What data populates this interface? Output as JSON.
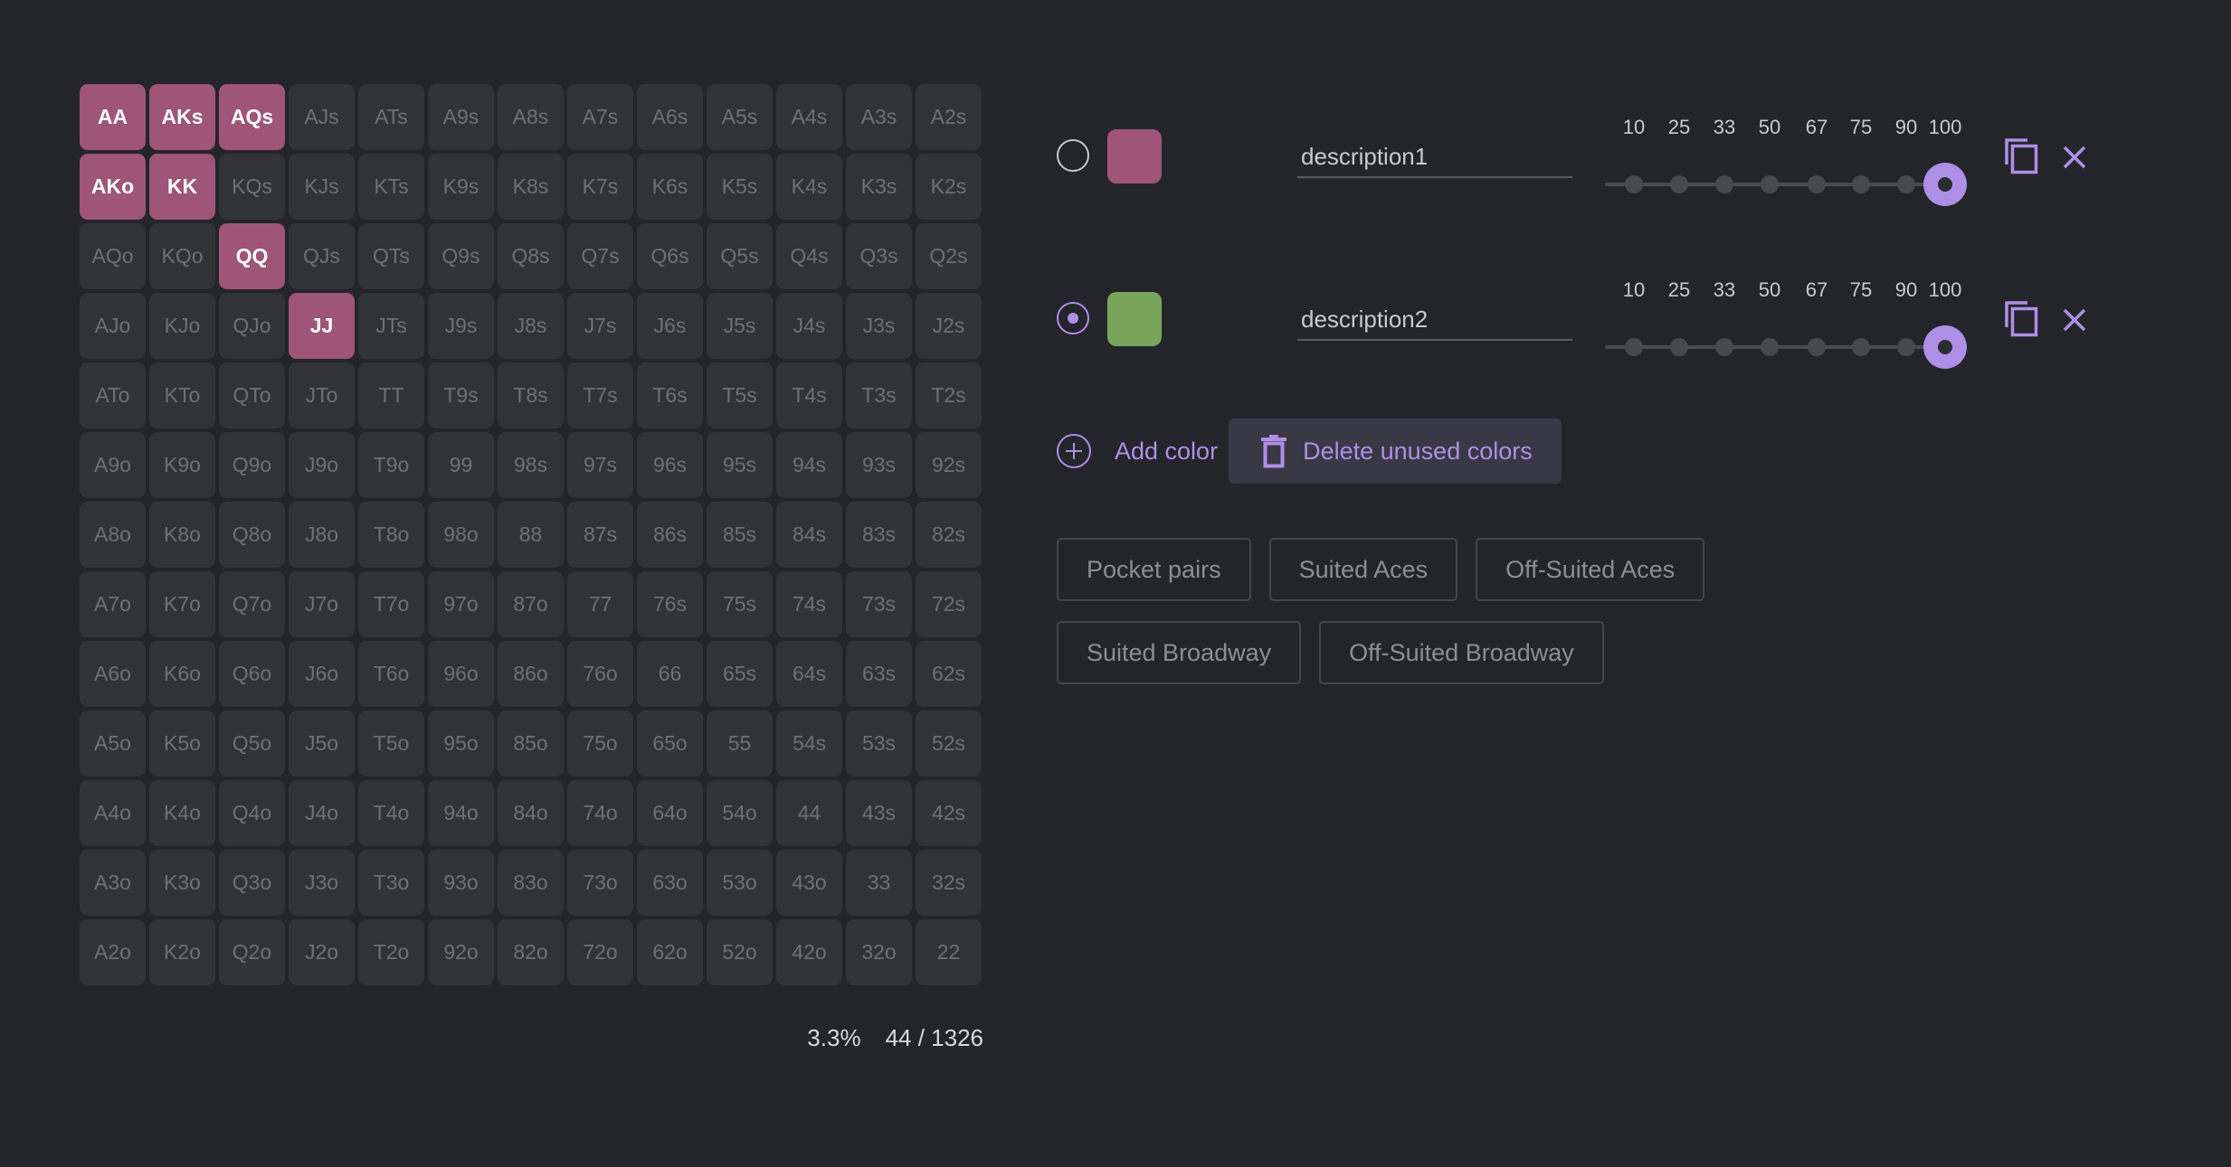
{
  "range_grid": {
    "selected_color": "#9e5577",
    "cells": [
      [
        "AA",
        "AKs",
        "AQs",
        "AJs",
        "ATs",
        "A9s",
        "A8s",
        "A7s",
        "A6s",
        "A5s",
        "A4s",
        "A3s",
        "A2s"
      ],
      [
        "AKo",
        "KK",
        "KQs",
        "KJs",
        "KTs",
        "K9s",
        "K8s",
        "K7s",
        "K6s",
        "K5s",
        "K4s",
        "K3s",
        "K2s"
      ],
      [
        "AQo",
        "KQo",
        "QQ",
        "QJs",
        "QTs",
        "Q9s",
        "Q8s",
        "Q7s",
        "Q6s",
        "Q5s",
        "Q4s",
        "Q3s",
        "Q2s"
      ],
      [
        "AJo",
        "KJo",
        "QJo",
        "JJ",
        "JTs",
        "J9s",
        "J8s",
        "J7s",
        "J6s",
        "J5s",
        "J4s",
        "J3s",
        "J2s"
      ],
      [
        "ATo",
        "KTo",
        "QTo",
        "JTo",
        "TT",
        "T9s",
        "T8s",
        "T7s",
        "T6s",
        "T5s",
        "T4s",
        "T3s",
        "T2s"
      ],
      [
        "A9o",
        "K9o",
        "Q9o",
        "J9o",
        "T9o",
        "99",
        "98s",
        "97s",
        "96s",
        "95s",
        "94s",
        "93s",
        "92s"
      ],
      [
        "A8o",
        "K8o",
        "Q8o",
        "J8o",
        "T8o",
        "98o",
        "88",
        "87s",
        "86s",
        "85s",
        "84s",
        "83s",
        "82s"
      ],
      [
        "A7o",
        "K7o",
        "Q7o",
        "J7o",
        "T7o",
        "97o",
        "87o",
        "77",
        "76s",
        "75s",
        "74s",
        "73s",
        "72s"
      ],
      [
        "A6o",
        "K6o",
        "Q6o",
        "J6o",
        "T6o",
        "96o",
        "86o",
        "76o",
        "66",
        "65s",
        "64s",
        "63s",
        "62s"
      ],
      [
        "A5o",
        "K5o",
        "Q5o",
        "J5o",
        "T5o",
        "95o",
        "85o",
        "75o",
        "65o",
        "55",
        "54s",
        "53s",
        "52s"
      ],
      [
        "A4o",
        "K4o",
        "Q4o",
        "J4o",
        "T4o",
        "94o",
        "84o",
        "74o",
        "64o",
        "54o",
        "44",
        "43s",
        "42s"
      ],
      [
        "A3o",
        "K3o",
        "Q3o",
        "J3o",
        "T3o",
        "93o",
        "83o",
        "73o",
        "63o",
        "53o",
        "43o",
        "33",
        "32s"
      ],
      [
        "A2o",
        "K2o",
        "Q2o",
        "J2o",
        "T2o",
        "92o",
        "82o",
        "72o",
        "62o",
        "52o",
        "42o",
        "32o",
        "22"
      ]
    ],
    "selected": [
      "AA",
      "AKs",
      "AQs",
      "AKo",
      "KK",
      "QQ",
      "JJ"
    ]
  },
  "stats": {
    "percent": "3.3%",
    "combos": "44 / 1326"
  },
  "colors": [
    {
      "swatch": "#9e5577",
      "description": "description1",
      "active": false,
      "frequency_options": [
        "10",
        "25",
        "33",
        "50",
        "67",
        "75",
        "90",
        "100"
      ],
      "frequency": "100",
      "copy_icon": "copy-icon",
      "delete_icon": "close-icon"
    },
    {
      "swatch": "#79a55a",
      "description": "description2",
      "active": true,
      "frequency_options": [
        "10",
        "25",
        "33",
        "50",
        "67",
        "75",
        "90",
        "100"
      ],
      "frequency": "100",
      "copy_icon": "copy-icon",
      "delete_icon": "close-icon"
    }
  ],
  "actions": {
    "add_color_label": "Add color",
    "delete_unused_label": "Delete unused colors"
  },
  "presets": [
    "Pocket pairs",
    "Suited Aces",
    "Off-Suited Aces",
    "Suited Broadway",
    "Off-Suited Broadway"
  ],
  "theme": {
    "background": "#24252b",
    "accent": "#ae8fe6",
    "cell_bg": "#323338",
    "cell_text": "#6f7071"
  }
}
